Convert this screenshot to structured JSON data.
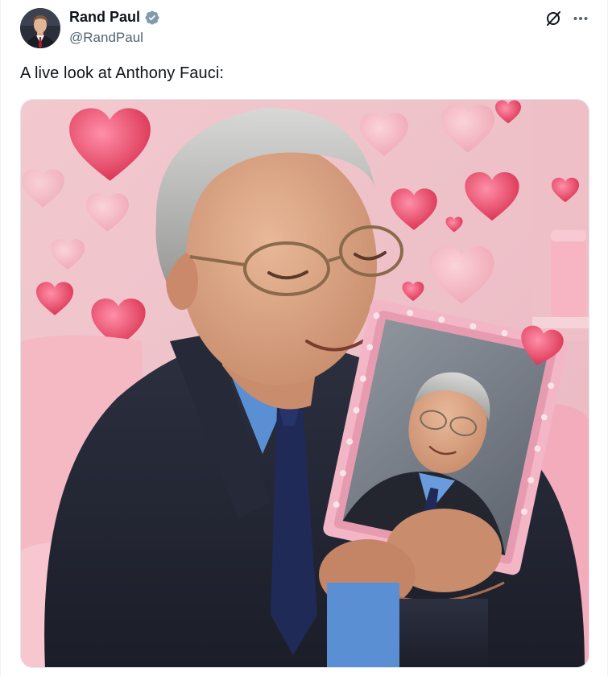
{
  "author": {
    "display_name": "Rand Paul",
    "handle": "@RandPaul",
    "verified": true
  },
  "tweet": {
    "text": "A live look at Anthony Fauci:"
  },
  "icons": {
    "verified": "verified-badge-icon",
    "grok": "grok-icon",
    "more": "more-options-icon"
  },
  "colors": {
    "text_primary": "#0f1419",
    "text_secondary": "#536471",
    "verified_badge": "#829aab"
  }
}
